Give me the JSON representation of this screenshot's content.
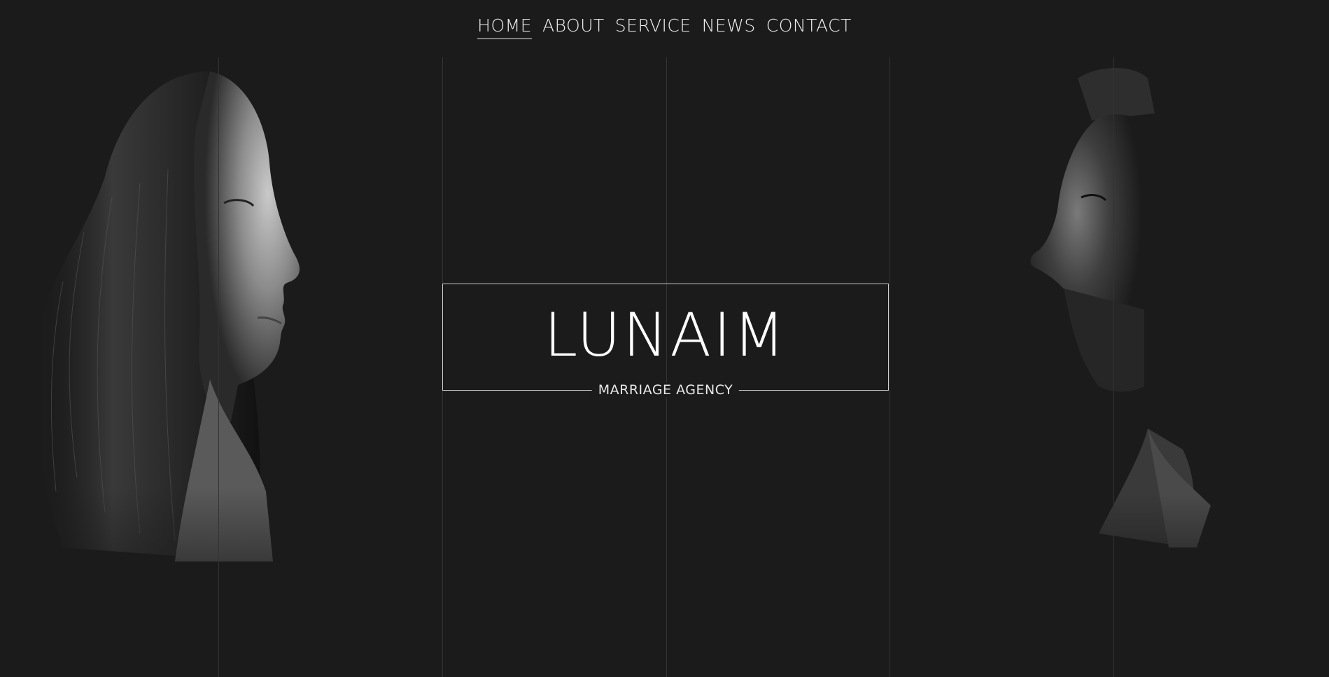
{
  "nav": {
    "items": [
      {
        "label": "HOME",
        "active": true
      },
      {
        "label": "ABOUT",
        "active": false
      },
      {
        "label": "SERVICE",
        "active": false
      },
      {
        "label": "NEWS",
        "active": false
      },
      {
        "label": "CONTACT",
        "active": false
      }
    ]
  },
  "hero": {
    "brand": "LUNAIM",
    "tagline": "MARRIAGE AGENCY",
    "left_image": "woman-profile-portrait",
    "right_image": "man-profile-portrait"
  },
  "colors": {
    "background": "#1b1b1b",
    "text": "#ffffff",
    "grid_line": "#333333",
    "frame": "#cfcfcf"
  }
}
